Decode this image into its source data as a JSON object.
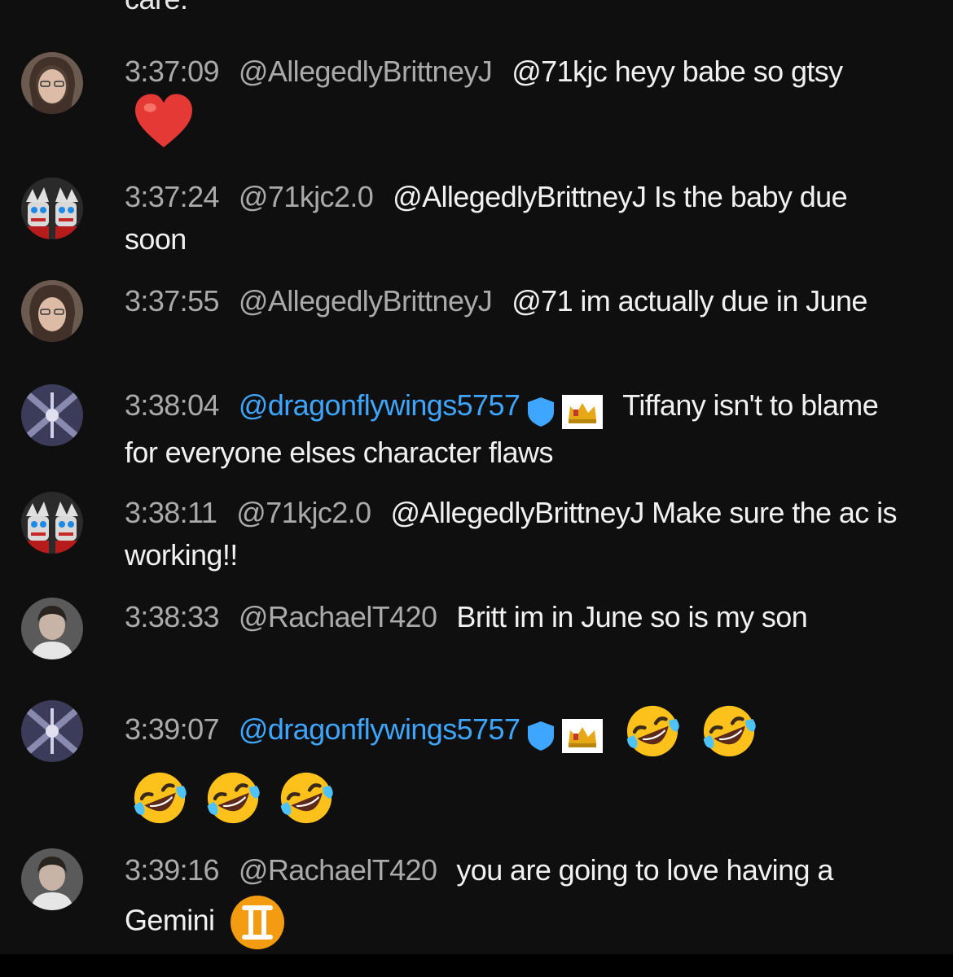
{
  "top_cut_text": "care.",
  "messages": [
    {
      "time": "3:37:09",
      "author": "@AllegedlyBrittneyJ",
      "text": "@71kjc heyy babe so gtsy"
    },
    {
      "time": "3:37:24",
      "author": "@71kjc2.0",
      "text": "@AllegedlyBrittneyJ Is the baby due soon"
    },
    {
      "time": "3:37:55",
      "author": "@AllegedlyBrittneyJ",
      "text": "@71 im actually due in June"
    },
    {
      "time": "3:38:04",
      "author": "@dragonflywings5757",
      "text": "Tiffany isn't to blame for everyone elses character flaws"
    },
    {
      "time": "3:38:11",
      "author": "@71kjc2.0",
      "text": "@AllegedlyBrittneyJ Make sure the ac is working!!"
    },
    {
      "time": "3:38:33",
      "author": "@RachaelT420",
      "text": "Britt im in June so is my son"
    },
    {
      "time": "3:39:07",
      "author": "@dragonflywings5757",
      "text": ""
    },
    {
      "time": "3:39:16",
      "author": "@RachaelT420",
      "text": "you are going to love having a Gemini"
    }
  ],
  "icons": {
    "heart": "red-heart-emoji",
    "laughing": "rolling-on-floor-laughing-emoji",
    "gemini": "gemini-zodiac-emoji",
    "moderator": "shield-badge",
    "member": "crown-badge"
  },
  "colors": {
    "background": "#0f0f0f",
    "meta": "#aaaaaa",
    "member_name": "#3ea6ff",
    "text": "#f1f1f1"
  }
}
